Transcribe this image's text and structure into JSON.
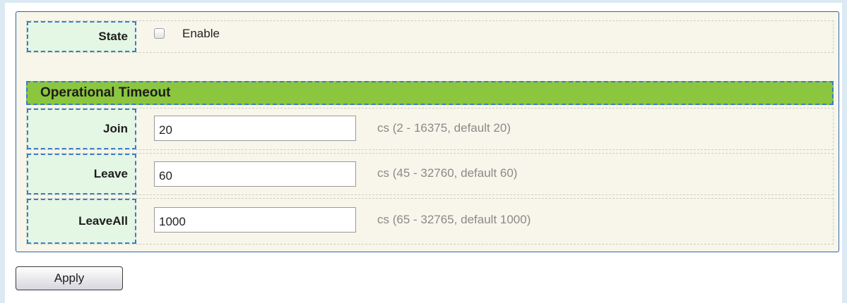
{
  "state": {
    "label": "State",
    "checkbox_label": "Enable",
    "checked": false
  },
  "section": {
    "title": "Operational Timeout"
  },
  "fields": {
    "join": {
      "label": "Join",
      "value": "20",
      "hint": "cs (2 - 16375, default 20)"
    },
    "leave": {
      "label": "Leave",
      "value": "60",
      "hint": "cs (45 - 32760, default 60)"
    },
    "leaveall": {
      "label": "LeaveAll",
      "value": "1000",
      "hint": "cs (65 - 32765, default 1000)"
    }
  },
  "actions": {
    "apply_label": "Apply"
  },
  "colors": {
    "section_bar": "#8cc63f",
    "label_cell": "#e4f6e4",
    "panel_bg": "#f8f6ea",
    "panel_border": "#2f64a6"
  }
}
